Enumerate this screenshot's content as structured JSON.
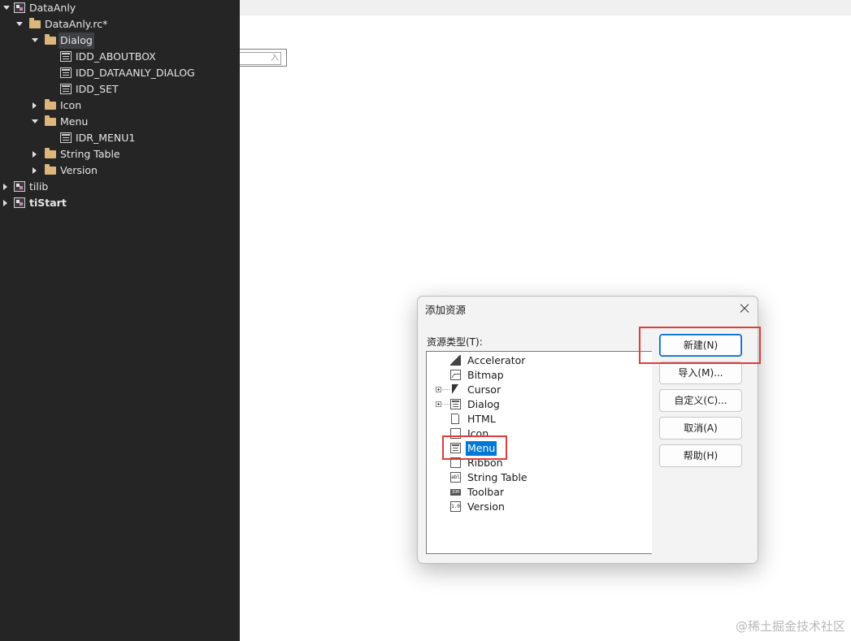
{
  "tree": {
    "items": [
      {
        "label": "DataAnly",
        "kind": "project",
        "expander": "down"
      },
      {
        "label": "DataAnly.rc*",
        "kind": "folder",
        "expander": "down"
      },
      {
        "label": "Dialog",
        "kind": "folder",
        "expander": "down",
        "selected": true
      },
      {
        "label": "IDD_ABOUTBOX",
        "kind": "dialog"
      },
      {
        "label": "IDD_DATAANLY_DIALOG",
        "kind": "dialog"
      },
      {
        "label": "IDD_SET",
        "kind": "dialog"
      },
      {
        "label": "Icon",
        "kind": "folder",
        "expander": "right"
      },
      {
        "label": "Menu",
        "kind": "folder",
        "expander": "down"
      },
      {
        "label": "IDR_MENU1",
        "kind": "menu"
      },
      {
        "label": "String Table",
        "kind": "folder",
        "expander": "right"
      },
      {
        "label": "Version",
        "kind": "folder",
        "expander": "right"
      },
      {
        "label": "tilib",
        "kind": "project",
        "expander": "right"
      },
      {
        "label": "tiStart",
        "kind": "project",
        "expander": "right",
        "bold": true
      }
    ]
  },
  "editor": {
    "stub_text": "入"
  },
  "dialog": {
    "title": "添加资源",
    "type_label": "资源类型(T):",
    "resource_types": [
      {
        "label": "Accelerator",
        "icon": "accelerator-icon"
      },
      {
        "label": "Bitmap",
        "icon": "bitmap-icon"
      },
      {
        "label": "Cursor",
        "icon": "cursor-icon",
        "expandable": true
      },
      {
        "label": "Dialog",
        "icon": "dialog-icon",
        "expandable": true
      },
      {
        "label": "HTML",
        "icon": "html-icon"
      },
      {
        "label": "Icon",
        "icon": "icon-icon"
      },
      {
        "label": "Menu",
        "icon": "menu-icon",
        "selected": true
      },
      {
        "label": "Ribbon",
        "icon": "ribbon-icon"
      },
      {
        "label": "String Table",
        "icon": "string-table-icon",
        "glyph": "abl"
      },
      {
        "label": "Toolbar",
        "icon": "toolbar-icon",
        "glyph": "IOH"
      },
      {
        "label": "Version",
        "icon": "version-icon",
        "glyph": "1.0"
      }
    ],
    "buttons": {
      "new": "新建(N)",
      "import": "导入(M)...",
      "custom": "自定义(C)...",
      "cancel": "取消(A)",
      "help": "帮助(H)"
    }
  },
  "watermark": "@稀土掘金技术社区"
}
